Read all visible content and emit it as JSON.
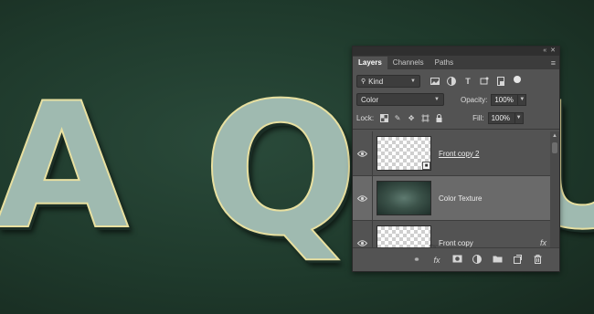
{
  "canvas": {
    "letters": [
      "A",
      "Q",
      "U"
    ]
  },
  "panel": {
    "header_controls": [
      "«",
      "✕"
    ],
    "tabs": [
      {
        "label": "Layers",
        "active": true
      },
      {
        "label": "Channels",
        "active": false
      },
      {
        "label": "Paths",
        "active": false
      }
    ],
    "menu_icon": "≡",
    "filter": {
      "kind_label": "Kind",
      "icons": [
        "image-filter-icon",
        "adjustment-filter-icon",
        "type-filter-icon",
        "shape-filter-icon",
        "smart-object-filter-icon"
      ]
    },
    "blend": {
      "mode": "Color",
      "opacity_label": "Opacity:",
      "opacity_value": "100%"
    },
    "lock": {
      "label": "Lock:",
      "fill_label": "Fill:",
      "fill_value": "100%"
    },
    "layers": [
      {
        "name": "Front copy 2",
        "selected": false,
        "thumb": "transparent",
        "smart": true,
        "fx": false
      },
      {
        "name": "Color Texture",
        "selected": true,
        "thumb": "texture",
        "smart": false,
        "fx": false
      },
      {
        "name": "Front copy",
        "selected": false,
        "thumb": "transparent",
        "smart": true,
        "fx": true
      }
    ],
    "fx_label": "fx"
  }
}
